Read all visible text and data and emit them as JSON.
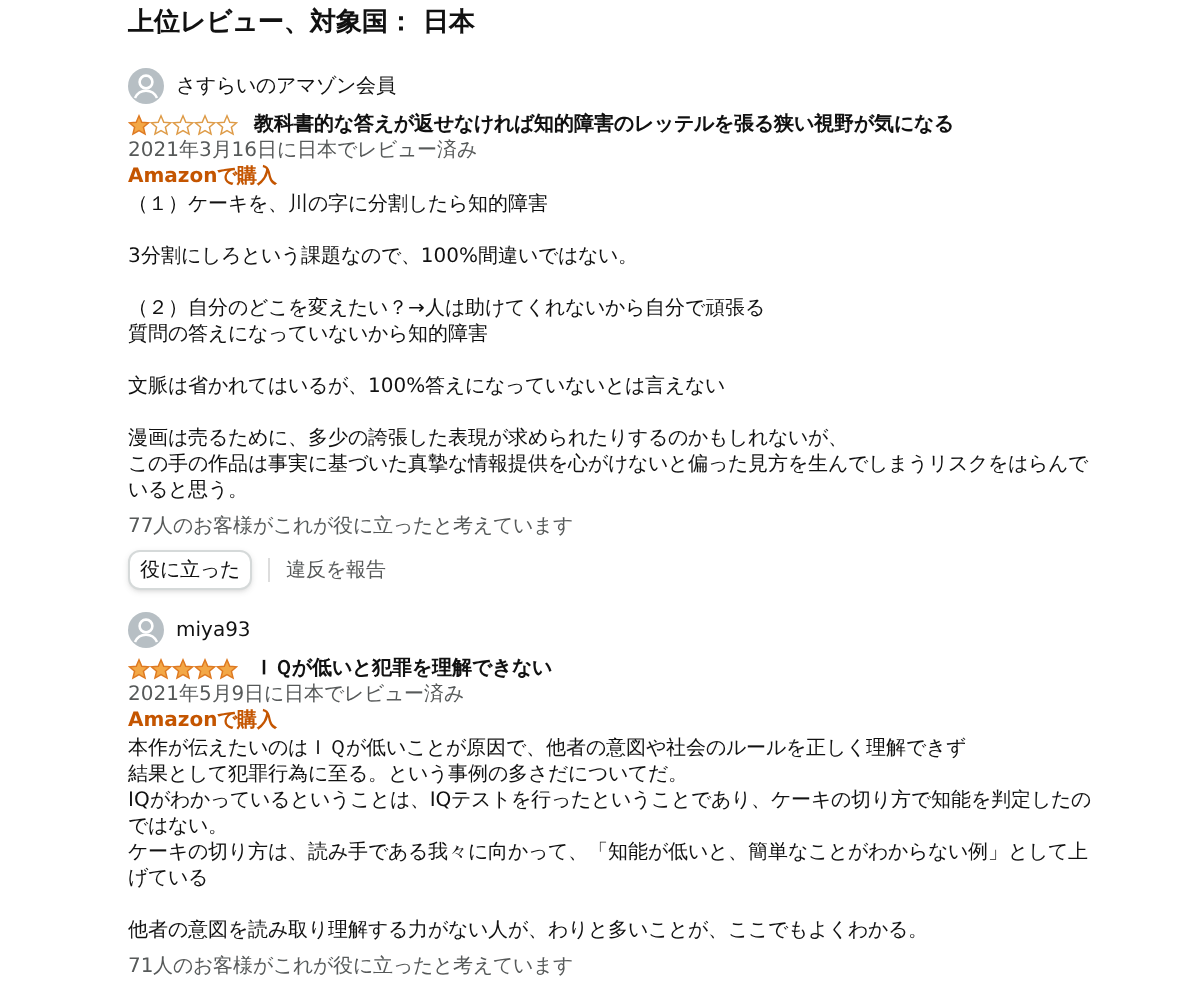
{
  "heading": "上位レビュー、対象国： 日本",
  "reviews": [
    {
      "reviewer": "さすらいのアマゾン会員",
      "stars": 1,
      "title": "教科書的な答えが返せなければ知的障害のレッテルを張る狭い視野が気になる",
      "date": "2021年3月16日に日本でレビュー済み",
      "badge": "Amazonで購入",
      "paragraphs": [
        [
          "（１）ケーキを、川の字に分割したら知的障害"
        ],
        [
          "3分割にしろという課題なので、100%間違いではない。"
        ],
        [
          "（２）自分のどこを変えたい？→人は助けてくれないから自分で頑張る",
          "質問の答えになっていないから知的障害"
        ],
        [
          "文脈は省かれてはいるが、100%答えになっていないとは言えない"
        ],
        [
          "漫画は売るために、多少の誇張した表現が求められたりするのかもしれないが、",
          "この手の作品は事実に基づいた真摯な情報提供を心がけないと偏った見方を生んでしまうリスクをはらんで",
          "いると思う。"
        ]
      ],
      "helpful": "77人のお客様がこれが役に立ったと考えています",
      "helpful_button": "役に立った",
      "report_link": "違反を報告"
    },
    {
      "reviewer": "miya93",
      "stars": 5,
      "title": "ＩＱが低いと犯罪を理解できない",
      "date": "2021年5月9日に日本でレビュー済み",
      "badge": "Amazonで購入",
      "paragraphs": [
        [
          "本作が伝えたいのはＩＱが低いことが原因で、他者の意図や社会のルールを正しく理解できず",
          "結果として犯罪行為に至る。という事例の多さだについてだ。",
          "IQがわかっているということは、IQテストを行ったということであり、ケーキの切り方で知能を判定したの",
          "ではない。",
          "ケーキの切り方は、読み手である我々に向かって、「知能が低いと、簡単なことがわからない例」として上",
          "げている"
        ],
        [
          "他者の意図を読み取り理解する力がない人が、わりと多いことが、ここでもよくわかる。"
        ]
      ],
      "helpful": "71人のお客様がこれが役に立ったと考えています"
    }
  ]
}
